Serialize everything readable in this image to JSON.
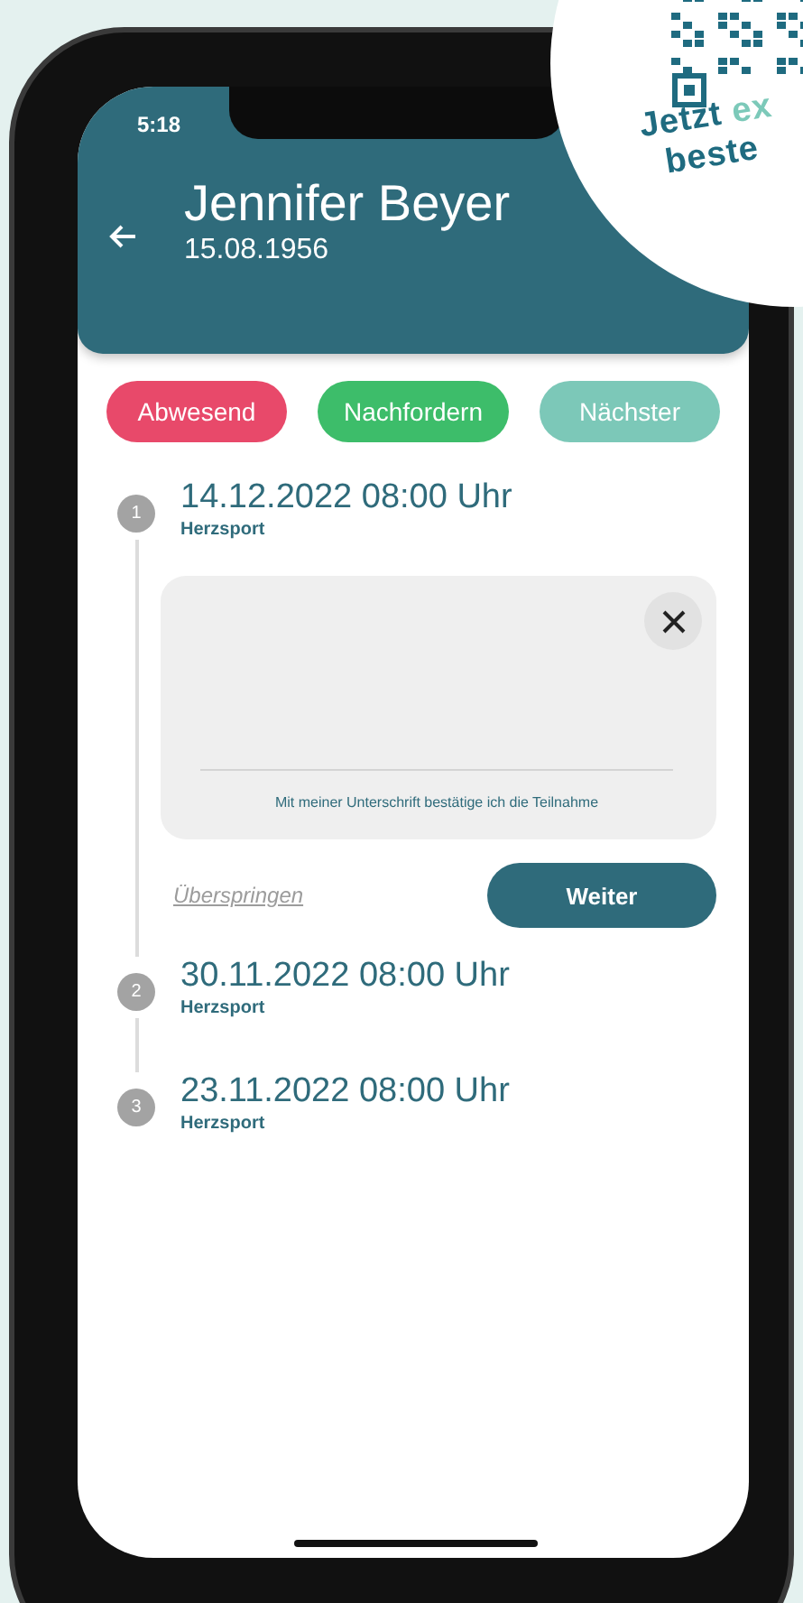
{
  "status_bar": {
    "time": "5:18"
  },
  "header": {
    "title": "Jennifer Beyer",
    "subtitle": "15.08.1956"
  },
  "actions": [
    {
      "label": "Abwesend",
      "color": "#e8496a"
    },
    {
      "label": "Nachfordern",
      "color": "#3dbd6a"
    },
    {
      "label": "Nächster",
      "color": "#7cc8b8"
    }
  ],
  "steps": [
    {
      "number": "1",
      "date": "14.12.2022 08:00 Uhr",
      "subtitle": "Herzsport",
      "signature": {
        "caption": "Mit meiner Unterschrift bestätige ich die Teilnahme"
      },
      "skip": "Überspringen",
      "next": "Weiter"
    },
    {
      "number": "2",
      "date": "30.11.2022 08:00 Uhr",
      "subtitle": "Herzsport"
    },
    {
      "number": "3",
      "date": "23.11.2022 08:00 Uhr",
      "subtitle": "Herzsport"
    }
  ],
  "badge": {
    "lines": [
      {
        "words": [
          {
            "text": "Jetzt",
            "color": "#1f6b80"
          },
          {
            "text": "ex",
            "color": "#7cc9b9"
          }
        ]
      },
      {
        "words": [
          {
            "text": "beste",
            "color": "#1f6b80"
          }
        ]
      }
    ]
  }
}
